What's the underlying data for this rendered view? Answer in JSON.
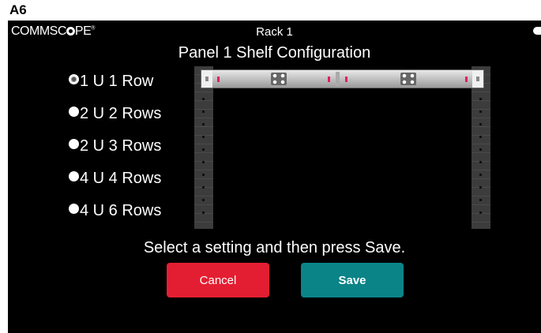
{
  "figure_label": "A6",
  "header": {
    "logo_text_pre": "COMMSC",
    "logo_text_post": "PE",
    "logo_mark": "®",
    "rack_title": "Rack 1",
    "page_title": "Panel 1 Shelf Configuration",
    "back_icon": "back-icon"
  },
  "options": [
    {
      "label": "1 U 1 Row",
      "selected": true
    },
    {
      "label": "2 U 2 Rows",
      "selected": false
    },
    {
      "label": "2 U 3 Rows",
      "selected": false
    },
    {
      "label": "4 U 4 Rows",
      "selected": false
    },
    {
      "label": "4 U 6 Rows",
      "selected": false
    }
  ],
  "instruction": "Select a setting and then press Save.",
  "buttons": {
    "cancel": "Cancel",
    "save": "Save"
  },
  "colors": {
    "background": "#000000",
    "cancel": "#e41e32",
    "save": "#0b8487",
    "marker": "#e31c5f"
  }
}
